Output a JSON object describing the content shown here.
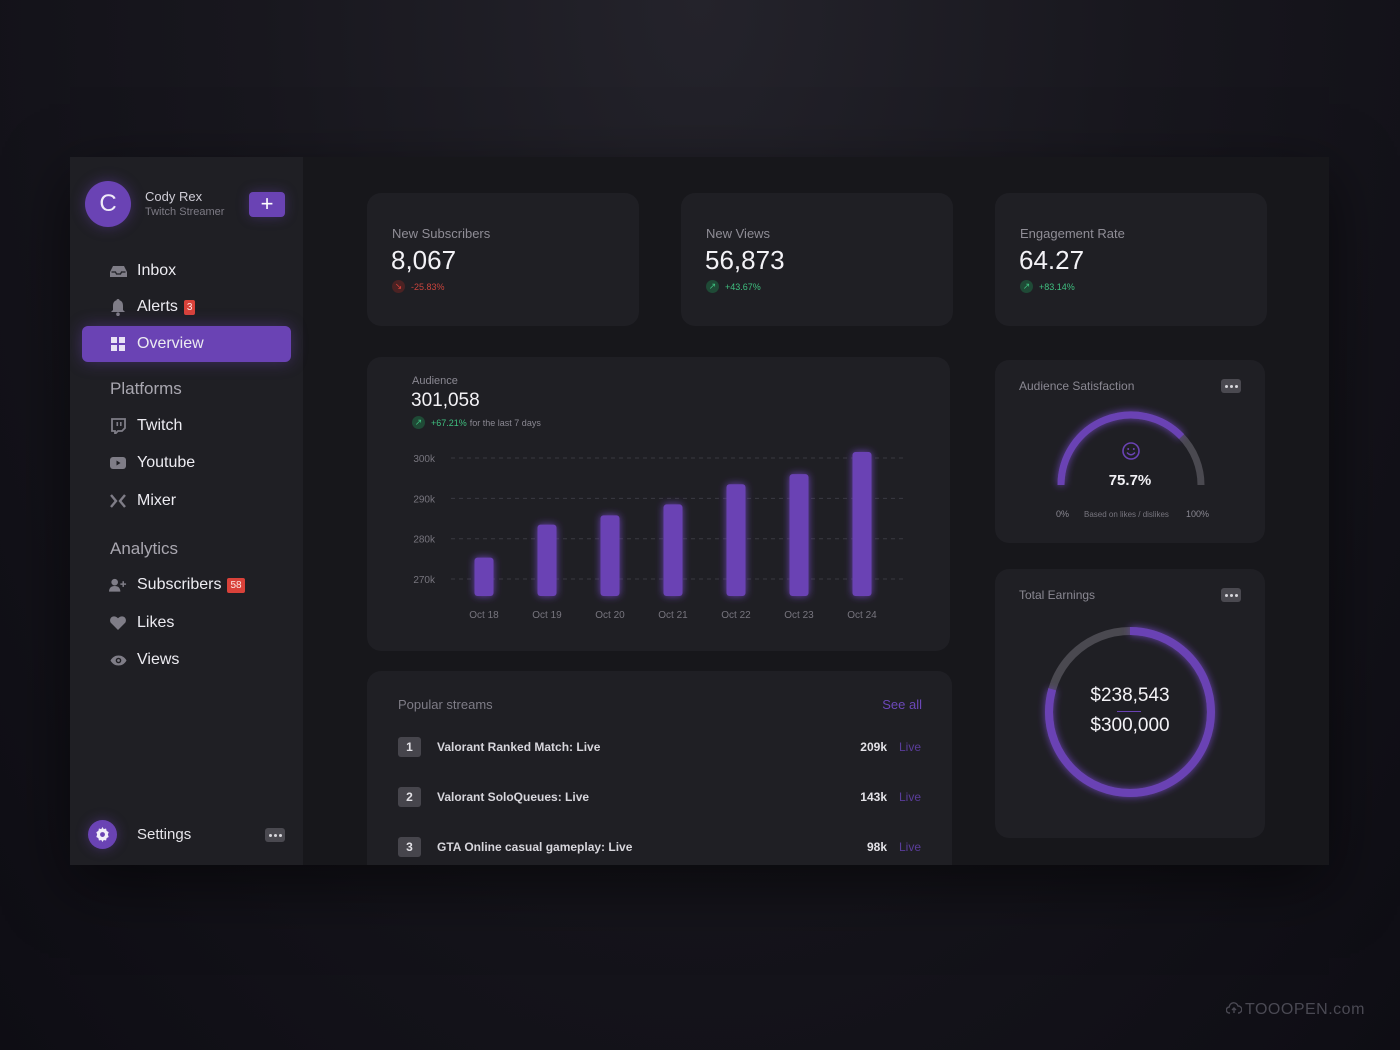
{
  "profile": {
    "initial": "C",
    "name": "Cody Rex",
    "role": "Twitch Streamer",
    "add_label": "+"
  },
  "nav": {
    "main": [
      {
        "label": "Inbox",
        "icon": "inbox-icon"
      },
      {
        "label": "Alerts",
        "icon": "bell-icon",
        "badge": "3"
      },
      {
        "label": "Overview",
        "icon": "grid-icon",
        "active": true
      }
    ],
    "platforms_label": "Platforms",
    "platforms": [
      {
        "label": "Twitch",
        "icon": "twitch-icon"
      },
      {
        "label": "Youtube",
        "icon": "youtube-icon"
      },
      {
        "label": "Mixer",
        "icon": "mixer-icon"
      }
    ],
    "analytics_label": "Analytics",
    "analytics": [
      {
        "label": "Subscribers",
        "icon": "add-user-icon",
        "badge": "58"
      },
      {
        "label": "Likes",
        "icon": "heart-icon"
      },
      {
        "label": "Views",
        "icon": "eye-icon"
      }
    ],
    "settings_label": "Settings"
  },
  "stats": [
    {
      "title": "New Subscribers",
      "value": "8,067",
      "change": "-25.83%",
      "trend": "down"
    },
    {
      "title": "New Views",
      "value": "56,873",
      "change": "+43.67%",
      "trend": "up"
    },
    {
      "title": "Engagement Rate",
      "value": "64.27",
      "change": "+83.14%",
      "trend": "up"
    }
  ],
  "audience": {
    "label": "Audience",
    "value": "301,058",
    "change": "+67.21%",
    "change_note": "for the last 7 days"
  },
  "chart_data": {
    "type": "bar",
    "title": "Audience",
    "categories": [
      "Oct 18",
      "Oct 19",
      "Oct 20",
      "Oct 21",
      "Oct 22",
      "Oct 23",
      "Oct 24"
    ],
    "values": [
      275300,
      283500,
      285800,
      288500,
      293500,
      296000,
      301500
    ],
    "yticks": [
      300000,
      290000,
      280000,
      270000
    ],
    "ytick_labels": [
      "300k",
      "290k",
      "280k",
      "270k"
    ],
    "ylim": [
      265800,
      301500
    ],
    "xlabel": "",
    "ylabel": "",
    "grid": true,
    "color": "#6a43b4"
  },
  "streams": {
    "title": "Popular streams",
    "see_all": "See all",
    "items": [
      {
        "rank": "1",
        "name": "Valorant Ranked Match: Live",
        "views": "209k",
        "status": "Live"
      },
      {
        "rank": "2",
        "name": "Valorant SoloQueues: Live",
        "views": "143k",
        "status": "Live"
      },
      {
        "rank": "3",
        "name": "GTA Online casual gameplay: Live",
        "views": "98k",
        "status": "Live"
      }
    ]
  },
  "satisfaction": {
    "title": "Audience Satisfaction",
    "value_label": "75.7%",
    "value": 0.757,
    "min_label": "0%",
    "max_label": "100%",
    "note": "Based on likes / dislikes"
  },
  "earnings": {
    "title": "Total Earnings",
    "value": "$238,543",
    "target": "$300,000",
    "fraction": 0.795
  },
  "colors": {
    "accent": "#6a43b4",
    "up": "#3fbf7f",
    "down": "#d9423a",
    "track": "#4a4950"
  },
  "watermark": "TOOOPEN.com"
}
